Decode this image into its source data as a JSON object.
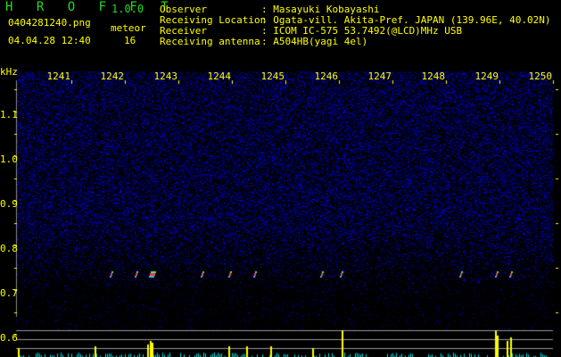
{
  "app": {
    "name": "H R O F F T",
    "version": "1.0.0"
  },
  "file": {
    "name": "0404281240.png",
    "datetime": "04.04.28 12:40"
  },
  "meteor": {
    "label": "meteor",
    "count": "16"
  },
  "info": [
    {
      "label": "Observer",
      "value": ": Masayuki Kobayashi"
    },
    {
      "label": "Receiving Location",
      "value": ": Ogata-vill. Akita-Pref. JAPAN (139.96E, 40.02N)"
    },
    {
      "label": "Receiver",
      "value": ": ICOM IC-575 53.7492(@LCD)MHz USB"
    },
    {
      "label": "Receiving antenna",
      "value": ": A504HB(yagi 4el)"
    }
  ],
  "axes": {
    "y_unit": "kHz",
    "x_ticks": [
      "1241",
      "1242",
      "1243",
      "1244",
      "1245",
      "1246",
      "1247",
      "1248",
      "1249",
      "1250"
    ],
    "y_ticks": [
      "1.1",
      "1.0",
      "0.9",
      "0.8",
      "0.7",
      "0.6"
    ]
  },
  "colors": {
    "text": "#ffff00",
    "title": "#22dd22",
    "noise": "#1a1aa0"
  }
}
